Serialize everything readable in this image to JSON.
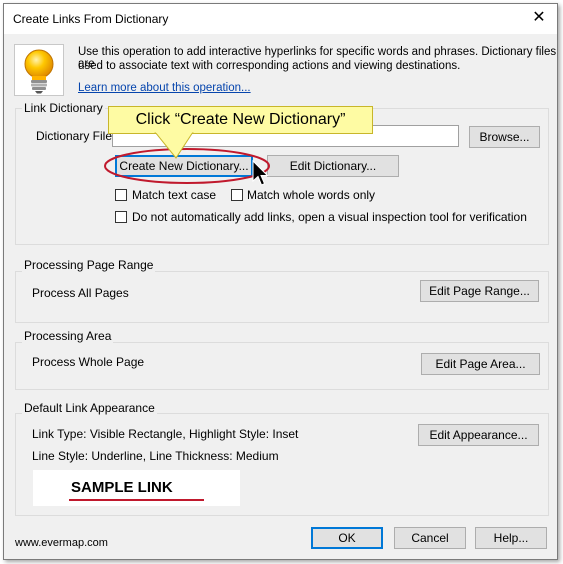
{
  "window": {
    "title": "Create Links From Dictionary",
    "close_glyph": "✕"
  },
  "intro": {
    "line1": "Use this operation to add interactive hyperlinks for specific words and phrases. Dictionary files are",
    "line2": "used to associate text with corresponding actions and viewing destinations.",
    "learn_more": "Learn more about this operation..."
  },
  "link_dictionary": {
    "group_label": "Link Dictionary",
    "file_label": "Dictionary File:",
    "file_value": "",
    "browse": "Browse...",
    "create_new": "Create New Dictionary...",
    "edit": "Edit Dictionary...",
    "match_case": "Match text case",
    "match_whole": "Match whole words only",
    "no_auto": "Do not automatically add links, open a visual inspection tool for verification"
  },
  "callout": {
    "text": "Click “Create New Dictionary”"
  },
  "page_range": {
    "group_label": "Processing Page Range",
    "value": "Process All Pages",
    "edit": "Edit Page Range..."
  },
  "area": {
    "group_label": "Processing Area",
    "value": "Process Whole Page",
    "edit": "Edit Page Area..."
  },
  "appearance": {
    "group_label": "Default Link Appearance",
    "line1": "Link Type: Visible Rectangle, Highlight Style: Inset",
    "line2": "Line Style: Underline, Line Thickness: Medium",
    "edit": "Edit Appearance...",
    "sample": "SAMPLE LINK"
  },
  "footer": {
    "website": "www.evermap.com",
    "ok": "OK",
    "cancel": "Cancel",
    "help": "Help..."
  },
  "colors": {
    "accent": "#0078d7",
    "callout_bg": "#fefba3",
    "highlight_ellipse": "#c0192d",
    "sample_underline": "#c0192d"
  }
}
